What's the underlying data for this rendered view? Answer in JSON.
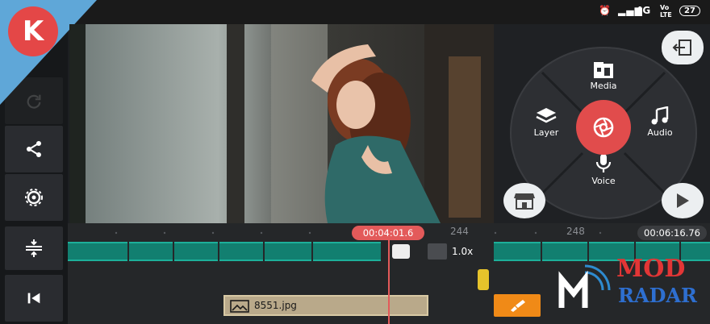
{
  "status": {
    "time_icons": "alarm",
    "network": "4G",
    "carrier": "Vo LTE",
    "battery": "27"
  },
  "preview": {
    "label": "preview"
  },
  "wheel": {
    "media": "Media",
    "layer": "Layer",
    "audio": "Audio",
    "voice": "Voice"
  },
  "timeline": {
    "playhead_time": "00:04:01.6",
    "duration": "00:06:16.76",
    "tick_244": "244",
    "tick_248": "248",
    "speed": "1.0x",
    "layer_clip_name": "8551.jpg"
  },
  "brand": {
    "line1": "MOD",
    "line2": "RADAR"
  },
  "colors": {
    "accent": "#e14c4c",
    "clip": "#127f70",
    "fx": "#f08a17",
    "logo_bg": "#5fa7d8"
  }
}
